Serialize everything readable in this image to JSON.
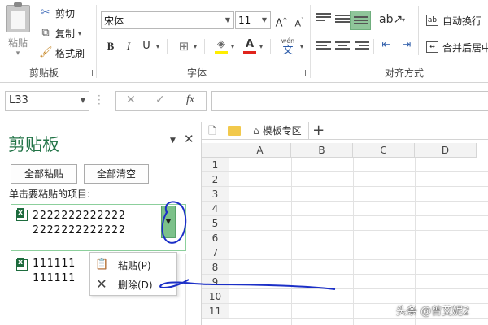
{
  "ribbon": {
    "clipboard": {
      "paste_label": "粘贴",
      "cut_label": "剪切",
      "copy_label": "复制",
      "format_painter_label": "格式刷",
      "group_label": "剪贴板"
    },
    "font": {
      "font_name": "宋体",
      "font_size": "11",
      "grow_label": "A",
      "shrink_label": "A",
      "bold_label": "B",
      "italic_label": "I",
      "underline_label": "U",
      "font_color_label": "A",
      "phonetic_label": "wén",
      "phonetic_char": "文",
      "group_label": "字体"
    },
    "alignment": {
      "wrap_text_label": "自动换行",
      "merge_label": "合并后居中",
      "group_label": "对齐方式"
    }
  },
  "formula_bar": {
    "name_box": "L33",
    "fx_label": "fx",
    "formula": ""
  },
  "clipboard_pane": {
    "title": "剪贴板",
    "paste_all_label": "全部粘贴",
    "clear_all_label": "全部清空",
    "hint": "单击要粘贴的项目:",
    "items": [
      {
        "lines": [
          "2222222222222",
          "2222222222222"
        ]
      },
      {
        "lines": [
          "111111",
          "111111"
        ]
      }
    ],
    "context_menu": {
      "paste_label": "粘贴(P)",
      "delete_label": "删除(D)"
    }
  },
  "sheet": {
    "tab_label": "模板专区",
    "columns": [
      "A",
      "B",
      "C",
      "D"
    ],
    "rows": [
      "1",
      "2",
      "3",
      "4",
      "5",
      "6",
      "7",
      "8",
      "9",
      "10",
      "11"
    ]
  },
  "watermark": "头条 @曾艾妮2",
  "colors": {
    "accent_green": "#217346",
    "selection_green": "#7cc18a",
    "annotation_blue": "#1b2fc7"
  }
}
